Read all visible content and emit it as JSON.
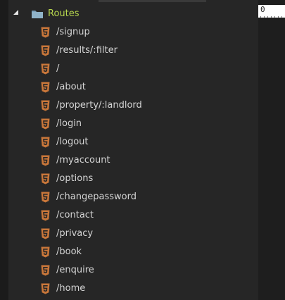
{
  "tree": {
    "folder": {
      "label": "Routes",
      "icon": "folder-icon",
      "expanded": true
    },
    "files": [
      {
        "label": "/signup",
        "icon": "html5-icon"
      },
      {
        "label": "/results/:filter",
        "icon": "html5-icon"
      },
      {
        "label": "/",
        "icon": "html5-icon"
      },
      {
        "label": "/about",
        "icon": "html5-icon"
      },
      {
        "label": "/property/:landlord",
        "icon": "html5-icon"
      },
      {
        "label": "/login",
        "icon": "html5-icon"
      },
      {
        "label": "/logout",
        "icon": "html5-icon"
      },
      {
        "label": "/myaccount",
        "icon": "html5-icon"
      },
      {
        "label": "/options",
        "icon": "html5-icon"
      },
      {
        "label": "/changepassword",
        "icon": "html5-icon"
      },
      {
        "label": "/contact",
        "icon": "html5-icon"
      },
      {
        "label": "/privacy",
        "icon": "html5-icon"
      },
      {
        "label": "/book",
        "icon": "html5-icon"
      },
      {
        "label": "/enquire",
        "icon": "html5-icon"
      },
      {
        "label": "/home",
        "icon": "html5-icon"
      }
    ]
  },
  "editor": {
    "ruler_start": "0"
  },
  "colors": {
    "panel_bg": "#262626",
    "folder_label": "#b8d84e",
    "file_label": "#d4d4d4",
    "html_icon": "#c9773a",
    "folder_icon": "#8fb3c9"
  }
}
